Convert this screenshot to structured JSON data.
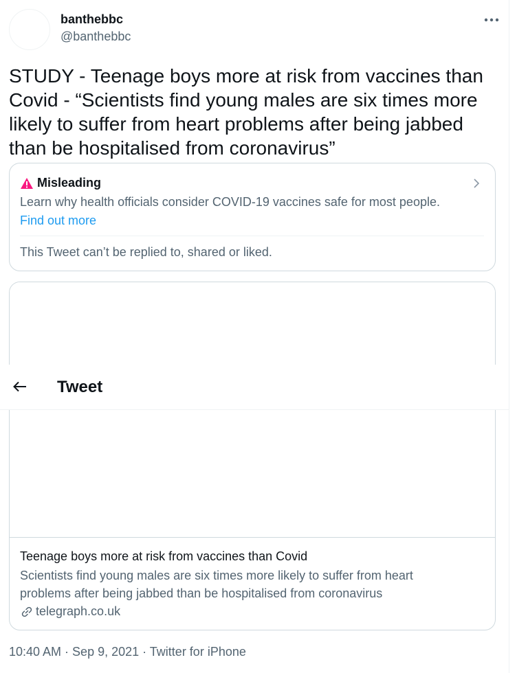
{
  "author": {
    "display_name": "banthebbc",
    "handle": "@banthebbc"
  },
  "tweet": {
    "text": "STUDY - Teenage boys more at risk from vaccines than Covid - “Scientists find young males are six times more likely to suffer from heart problems after being jabbed than be hospitalised from coronavirus”",
    "timestamp": "10:40 AM · Sep 9, 2021 · Twitter for iPhone"
  },
  "notice": {
    "title": "Misleading",
    "description": "Learn why health officials consider COVID-19 vaccines safe for most people.",
    "link_label": "Find out more",
    "footer": "This Tweet can’t be replied to, shared or liked.",
    "accent_color": "#f91880",
    "link_color": "#1d9bf0"
  },
  "link_card": {
    "title": "Teenage boys more at risk from vaccines than Covid",
    "description": "Scientists find young males are six times more likely to suffer from heart problems after being jabbed than be hospitalised from coronavirus",
    "domain": "telegraph.co.uk"
  },
  "topbar": {
    "title": "Tweet"
  },
  "icons": {
    "more": "more-horizontal-icon",
    "warning": "warning-triangle-icon",
    "chevron": "chevron-right-icon",
    "link": "link-icon",
    "back": "back-arrow-icon"
  }
}
